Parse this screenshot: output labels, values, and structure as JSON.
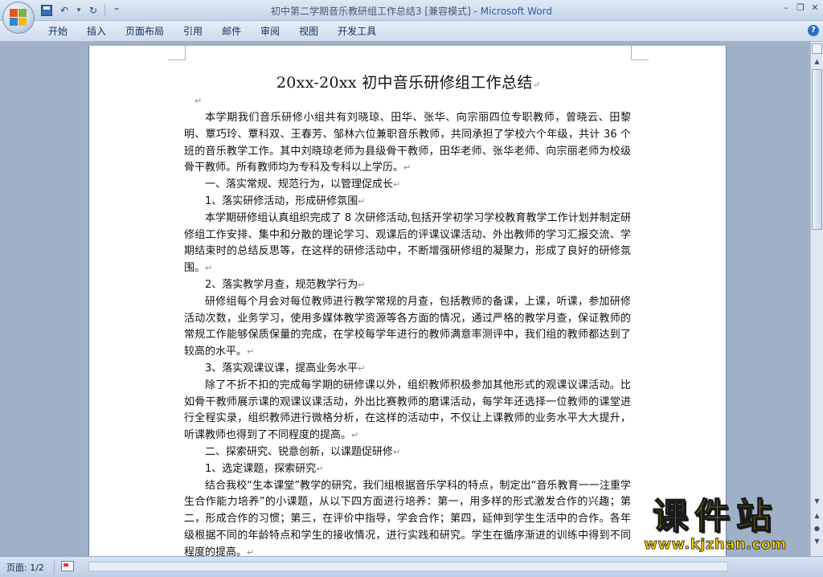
{
  "window": {
    "title": "初中第二学期音乐教研组工作总结3 [兼容模式]",
    "title_sep": " - ",
    "app_name": "Microsoft Word",
    "minimize": "–",
    "restore": "❐",
    "close": "✕"
  },
  "qat": {
    "undo_glyph": "↶",
    "dropdown_glyph": "▾",
    "redo_glyph": "↻",
    "customize_glyph": "⁼"
  },
  "ribbon": {
    "tabs": [
      "开始",
      "插入",
      "页面布局",
      "引用",
      "邮件",
      "审阅",
      "视图",
      "开发工具"
    ],
    "help": "?"
  },
  "document": {
    "title": "20xx-20xx 初中音乐研修组工作总结",
    "paragraph_mark": "↵",
    "paragraphs": [
      "本学期我们音乐研修小组共有刘晓琼、田华、张华、向宗丽四位专职教师，曾晓云、田黎明、覃巧玲、覃科双、王春芳、邹林六位兼职音乐教师，共同承担了学校六个年级，共计 36 个班的音乐教学工作。其中刘晓琼老师为县级骨干教师，田华老师、张华老师、向宗丽老师为校级骨干教师。所有教师均为专科及专科以上学历。",
      "一、落实常规、规范行为，以管理促成长",
      "1、落实研修活动，形成研修氛围",
      "本学期研修组认真组织完成了 8 次研修活动,包括开学初学习学校教育教学工作计划并制定研修组工作安排、集中和分散的理论学习、观课后的评课议课活动、外出教师的学习汇报交流、学期结束时的总结反思等，在这样的研修活动中，不断增强研修组的凝聚力，形成了良好的研修氛围。",
      "2、落实教学月查，规范教学行为",
      "研修组每个月会对每位教师进行教学常规的月查，包括教师的备课，上课，听课，参加研修活动次数，业务学习，使用多媒体教学资源等各方面的情况，通过严格的教学月查，保证教师的常规工作能够保质保量的完成，在学校每学年进行的教师满意率测评中，我们组的教师都达到了较高的水平。",
      "3、落实观课议课，提高业务水平",
      "除了不折不扣的完成每学期的研修课以外，组织教师积极参加其他形式的观课议课活动。比如骨干教师展示课的观课议课活动，外出比赛教师的磨课活动，每学年还选择一位教师的课堂进行全程实录，组织教师进行微格分析，在这样的活动中，不仅让上课教师的业务水平大大提升，听课教师也得到了不同程度的提高。",
      "二、探索研究、锐意创新，以课题促研修",
      "1、选定课题，探索研究",
      "结合我校“生本课堂”教学的研究，我们组根据音乐学科的特点，制定出“音乐教育一一注重学生合作能力培养”的小课题，从以下四方面进行培养：第一，用多样的形式激发合作的兴趣；第二，形成合作的习惯；第三，在评价中指导，学会合作；第四，延伸到学生生活中的合作。各年级根据不同的年龄特点和学生的接收情况，进行实践和研究。学生在循序渐进的训练中得到不同程度的提高。"
    ]
  },
  "scrollbar": {
    "up": "▲",
    "down": "▼",
    "prev_page": "▲",
    "next_page": "▼",
    "select_browse": "●"
  },
  "status": {
    "page": "页面: 1/2"
  },
  "watermark": {
    "brand": "课件站",
    "url": "www.kjzhan.com"
  },
  "colors": {
    "app_name": "#2c5faa",
    "watermark": "#f4d000",
    "ribbon_text": "#15315a"
  }
}
